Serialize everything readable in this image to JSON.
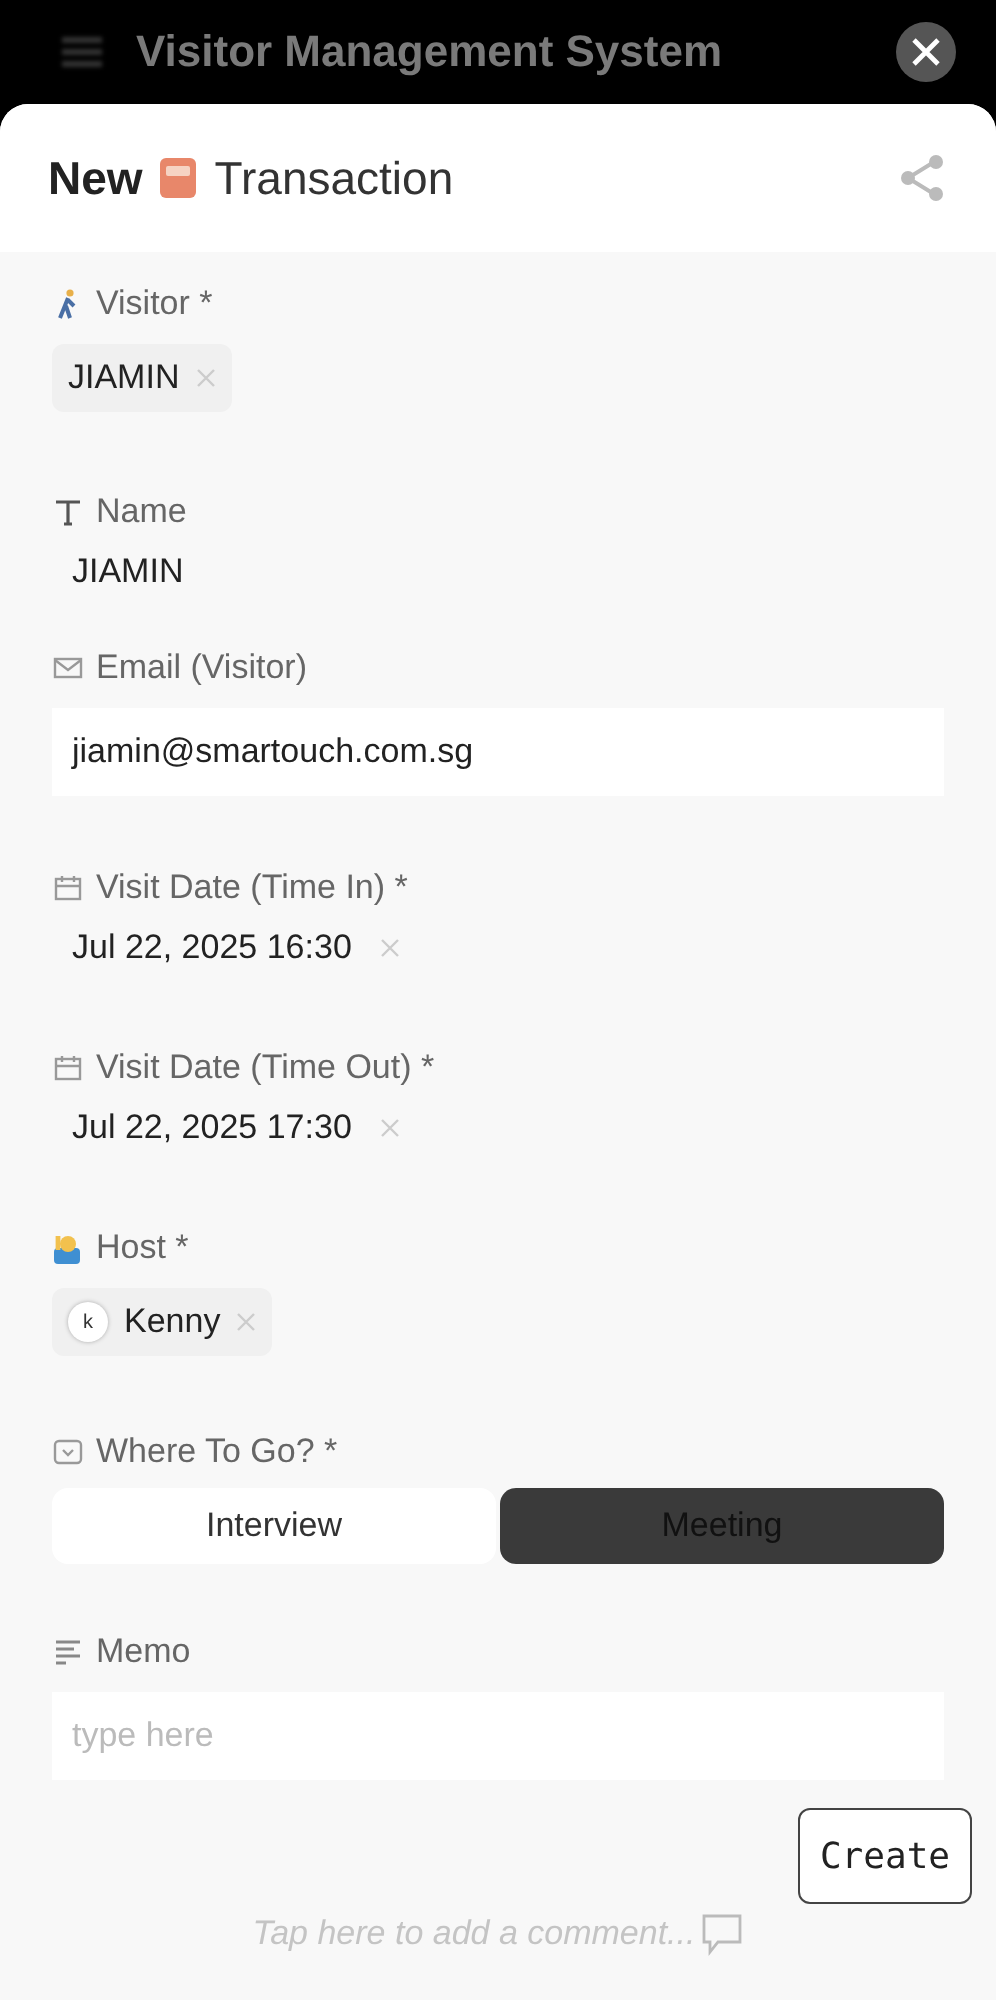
{
  "backdrop": {
    "title": "Visitor Management System"
  },
  "sheet": {
    "title_prefix": "New",
    "title": "Transaction"
  },
  "fields": [
    {
      "kind": "chip",
      "label": "Visitor *",
      "value": "JIAMIN"
    },
    {
      "kind": "text",
      "label": "Name",
      "value": "JIAMIN"
    },
    {
      "kind": "input",
      "label": "Email (Visitor)",
      "value": "jiamin@smartouch.com.sg"
    },
    {
      "kind": "date",
      "label": "Visit Date (Time In) *",
      "value": "Jul 22, 2025 16:30"
    },
    {
      "kind": "date",
      "label": "Visit Date (Time Out) *",
      "value": "Jul 22, 2025 17:30"
    },
    {
      "kind": "person",
      "label": "Host *",
      "value": "Kenny",
      "initial": "k"
    },
    {
      "kind": "segmented",
      "label": "Where To Go? *",
      "options": [
        {
          "label": "Interview",
          "selected": false
        },
        {
          "label": "Meeting",
          "selected": true
        }
      ]
    },
    {
      "kind": "textarea",
      "label": "Memo",
      "placeholder": "type here"
    }
  ],
  "create_button": "Create",
  "comment_hint": "Tap here to add a comment..."
}
